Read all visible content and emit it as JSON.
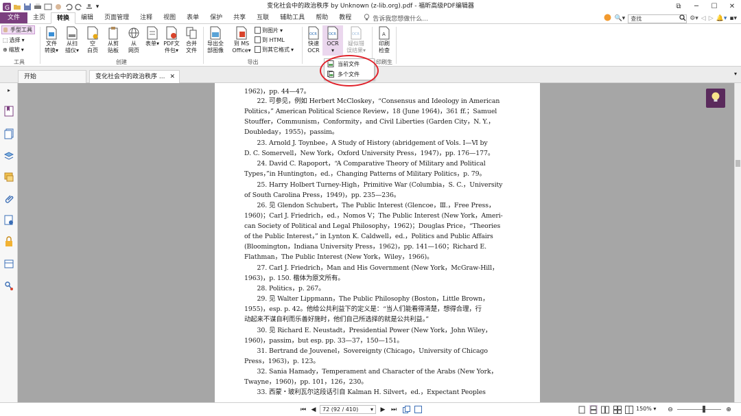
{
  "window": {
    "title": "变化社会中的政治秩序 by Unknown (z-lib.org).pdf - 福昕高级PDF编辑器"
  },
  "menu": {
    "tabs": [
      "文件",
      "主页",
      "转换",
      "编辑",
      "页面管理",
      "注释",
      "视图",
      "表单",
      "保护",
      "共享",
      "互联",
      "辅助工具",
      "帮助",
      "教程"
    ],
    "active_index": 2,
    "tell_me": "告诉我您想做什么...",
    "search_placeholder": "查找"
  },
  "ribbon": {
    "tools": {
      "hand": "手型工具",
      "select": "选择",
      "zoom": "缩放",
      "label": "工具"
    },
    "create": {
      "file_convert": [
        "文件",
        "转换"
      ],
      "from_scan": [
        "从扫",
        "描仪"
      ],
      "blank": [
        "空",
        "白页"
      ],
      "from_clip": [
        "从剪",
        "贴板"
      ],
      "from_web": [
        "从",
        "网页"
      ],
      "form": [
        "表单",
        ""
      ],
      "pdf_pkg": [
        "PDF文",
        "件包"
      ],
      "merge": [
        "合并",
        "文件"
      ],
      "label": "创建"
    },
    "export": {
      "export_all_images": [
        "导出全",
        "部图像"
      ],
      "to_ms_office": [
        "到 MS",
        "Office"
      ],
      "to_image": "到图片",
      "to_html": "到 HTML",
      "to_other": "到其它格式",
      "label": "导出"
    },
    "ocr": {
      "quick_ocr": [
        "快速",
        "OCR"
      ],
      "ocr": [
        "OCR",
        ""
      ],
      "suspect": [
        "疑似错",
        "误结果"
      ]
    },
    "preflight": {
      "check": [
        "印刷",
        "检查"
      ],
      "label": "印刷生"
    }
  },
  "ocr_dropdown": {
    "items": [
      "当前文件",
      "多个文件"
    ]
  },
  "doc_tabs": [
    "开始",
    "变化社会中的政治秩序 ..."
  ],
  "page_lines": [
    "1962)，pp. 44—47。",
    "　　22. 可参见，例如 Herbert McCloskey，“Consensus and Ideology in American",
    "Politics，” American Political Science Review，18 (June 1964)，361 ff.；Samuel",
    "Stouffer，Communism，Conformity，and Civil Liberties (Garden City，N. Y.，",
    "Doubleday，1955)，passim。",
    "　　23. Arnold J. Toynbee，A Study of History (abridgement of Vols. Ⅰ—Ⅵ by",
    "D. C. Somervell，New York，Oxford University Press，1947)，pp. 176—177。",
    "　　24. David C. Rapoport，“A Comparative Theory of Military and Political",
    "Types，”in Huntington，ed.，Changing Patterns of Military Politics，p. 79。",
    "　　25. Harry Holbert Turney-High，Primitive War (Columbia，S. C.，University",
    "of South Carolina Press，1949)，pp. 235—236。",
    "　　26. 见 Glendon Schubert，The Public Interest (Glencoe，Ⅲ.，Free Press，",
    "1960)；Carl J. Friedrich，ed.，Nomos V；The Public Interest (New York，Ameri-",
    "can Society of Political and Legal Philosophy，1962)；Douglas Price，“Theories",
    "of the Public Interest，” in Lynton K. Caldwell，ed.，Politics and Public Affairs",
    "(Bloomington，Indiana University Press，1962)，pp. 141—160；Richard E.",
    "Flathman，The Public Interest (New York，Wiley，1966)。",
    "　　27. Carl J. Friedrich，Man and His Government (New York，McGraw-Hill，",
    "1963)，p. 150. 楷体为原文所有。",
    "　　28. Politics，p. 267。",
    "　　29. 见 Walter Lippmann，The Public Philosophy (Boston，Little Brown，",
    "1955)，esp. p. 42。他给公共利益下的定义是：“当人们能看得清楚，想得合理，行",
    "动起来不谋自利而乐善好施时，他们自己所选择的就是公共利益。”",
    "　　30. 见 Richard E. Neustadt，Presidential Power (New York，John Wiley，",
    "1960)，passim，but esp. pp. 33—37，150—151。",
    "　　31. Bertrand de Jouvenel，Sovereignty (Chicago，University of Chicago",
    "Press，1963)，p. 123。",
    "　　32. Sania Hamady，Temperament and Character of the Arabs (New York，",
    "Twayne，1960)，pp. 101，126，230。",
    "　　33. 西蒙・玻利瓦尔这段话引自 Kalman H. Silvert，ed.，Expectant Peoples"
  ],
  "status": {
    "page_indicator": "72 (92 / 410)",
    "zoom": "150%"
  },
  "colors": {
    "accent": "#7b3f7f",
    "bulb_bg": "#5a2a5c",
    "annotation_red": "#e0212a"
  }
}
